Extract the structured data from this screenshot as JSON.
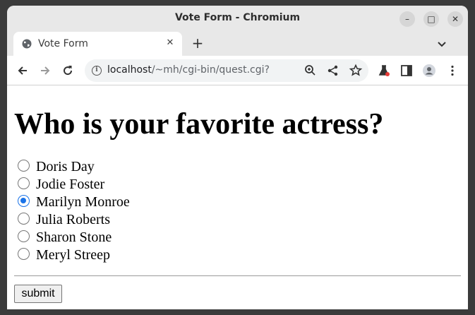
{
  "window": {
    "title": "Vote Form - Chromium",
    "minimize_glyph": "–",
    "maximize_glyph": "□",
    "close_glyph": "✕"
  },
  "tab": {
    "title": "Vote Form",
    "close_glyph": "✕",
    "icon": "globe-icon"
  },
  "newtab_glyph": "+",
  "omnibox": {
    "url_host": "localhost",
    "url_path": "/~mh/cgi-bin/quest.cgi?",
    "info_glyph": "i"
  },
  "page": {
    "heading": "Who is your favorite actress?",
    "options": [
      {
        "label": "Doris Day",
        "checked": false
      },
      {
        "label": "Jodie Foster",
        "checked": false
      },
      {
        "label": "Marilyn Monroe",
        "checked": true
      },
      {
        "label": "Julia Roberts",
        "checked": false
      },
      {
        "label": "Sharon Stone",
        "checked": false
      },
      {
        "label": "Meryl Streep",
        "checked": false
      }
    ],
    "submit_label": "submit"
  },
  "colors": {
    "accent": "#1a73e8",
    "titlebar": "#e8e8e8"
  }
}
